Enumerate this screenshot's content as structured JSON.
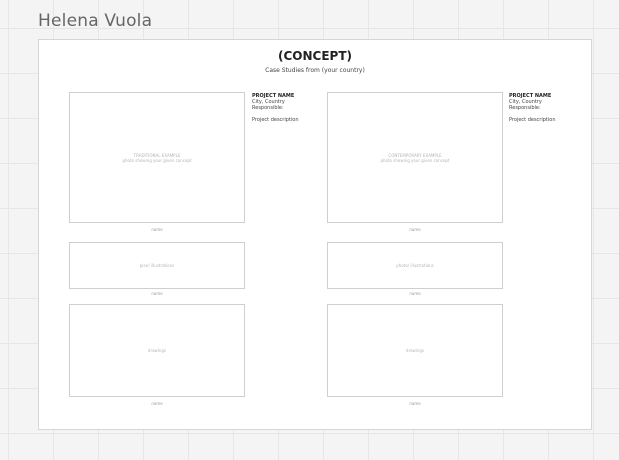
{
  "owner": "Helena Vuola",
  "board": {
    "title": "(CONCEPT)",
    "subtitle": "Case Studies from (your country)",
    "left": {
      "main_frame": {
        "line1": "TRADITIONAL EXAMPLE",
        "line2": "photo showing your given concept"
      },
      "main_caption": "name",
      "mid_frame": "plan/ illustrations",
      "mid_caption": "name",
      "bottom_frame": "drawings",
      "bottom_caption": "name",
      "info": {
        "project_name": "PROJECT NAME",
        "location": "City, Country",
        "responsible": "Responsible:",
        "description": "Project description"
      }
    },
    "right": {
      "main_frame": {
        "line1": "CONTEMPORARY EXAMPLE",
        "line2": "photo showing your given concept"
      },
      "main_caption": "name",
      "mid_frame": "photo/ illustrations",
      "mid_caption": "name",
      "bottom_frame": "drawings",
      "bottom_caption": "name",
      "info": {
        "project_name": "PROJECT NAME",
        "location": "City, Country",
        "responsible": "Responsible:",
        "description": "Project description"
      }
    }
  }
}
